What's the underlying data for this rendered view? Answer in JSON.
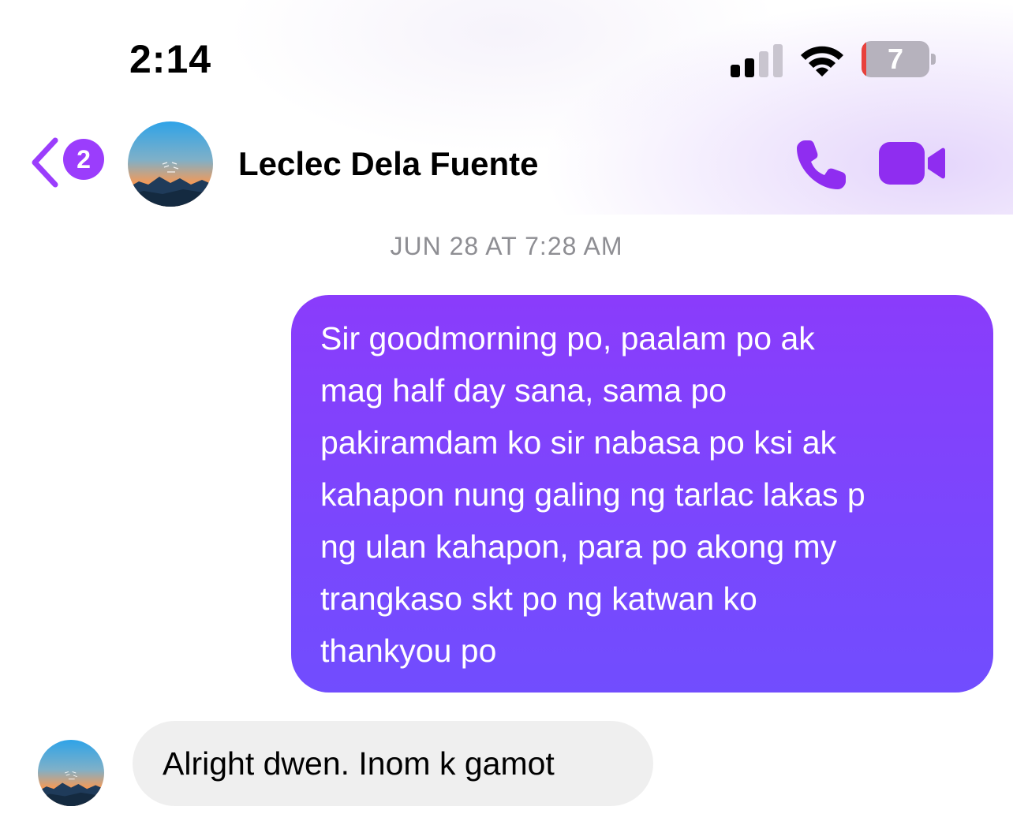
{
  "status_bar": {
    "time": "2:14",
    "battery_level": "7",
    "battery_fraction": 0.07,
    "signal_bars_active": 2,
    "signal_bars_total": 4,
    "icons": [
      "cellular-signal-icon",
      "wifi-icon",
      "battery-icon"
    ]
  },
  "header": {
    "back_badge_count": "2",
    "contact_name": "Leclec Dela Fuente",
    "icons": [
      "back-chevron-icon",
      "phone-icon",
      "video-camera-icon"
    ]
  },
  "thread": {
    "timestamp": "JUN 28 AT 7:28 AM",
    "messages": [
      {
        "direction": "outgoing",
        "text": "Sir goodmorning po, paalam po ak\nmag half day sana, sama po\npakiramdam ko sir nabasa po ksi ak\nkahapon nung galing ng tarlac lakas p\nng ulan kahapon, para po akong my\ntrangkaso skt po ng katwan ko\nthankyou po"
      },
      {
        "direction": "incoming",
        "text": "Alright dwen. Inom k gamot"
      }
    ]
  },
  "colors": {
    "accent": "#9b3dfc",
    "outgoing_bubble_top": "#8a3cfb",
    "outgoing_bubble_bottom": "#714dfe",
    "incoming_bubble": "#efefef",
    "timestamp_text": "#8e8e93",
    "battery_low": "#e8413c"
  }
}
